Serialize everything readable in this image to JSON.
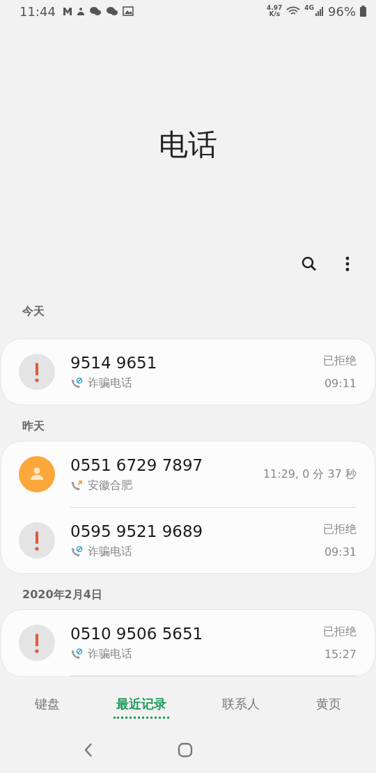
{
  "status_bar": {
    "time": "11:44",
    "speed_value": "4.97",
    "speed_unit": "K/s",
    "network": "4G",
    "battery": "96%"
  },
  "title": "电话",
  "sections": [
    {
      "label": "今天",
      "calls": [
        {
          "kind": "spam",
          "number": "9514 9651",
          "label": "诈骗电话",
          "status": "已拒绝",
          "time": "09:11"
        }
      ]
    },
    {
      "label": "昨天",
      "calls": [
        {
          "kind": "outgoing",
          "number": "0551 6729 7897",
          "label": "安徽合肥",
          "time": "11:29, 0 分 37 秒"
        },
        {
          "kind": "spam",
          "number": "0595 9521 9689",
          "label": "诈骗电话",
          "status": "已拒绝",
          "time": "09:31"
        }
      ]
    },
    {
      "label": "2020年2月4日",
      "calls": [
        {
          "kind": "spam",
          "number": "0510 9506 5651",
          "label": "诈骗电话",
          "status": "已拒绝",
          "time": "15:27"
        }
      ]
    }
  ],
  "tabs": [
    {
      "label": "键盘",
      "selected": false
    },
    {
      "label": "最近记录",
      "selected": true
    },
    {
      "label": "联系人",
      "selected": false
    },
    {
      "label": "黄页",
      "selected": false
    }
  ]
}
